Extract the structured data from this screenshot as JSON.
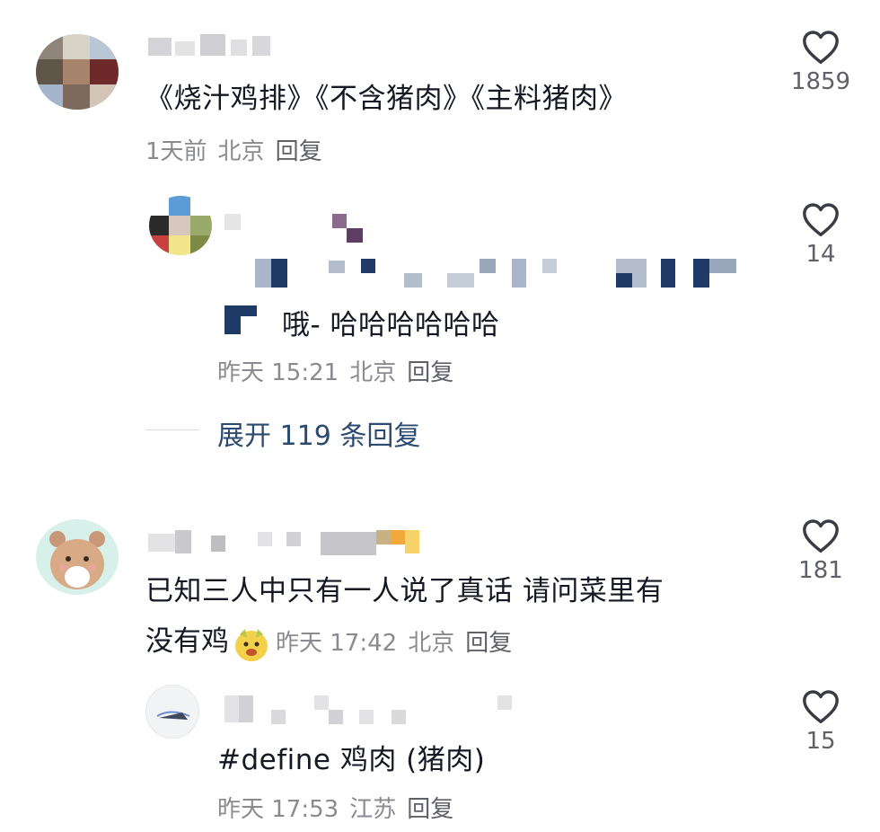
{
  "comments": [
    {
      "content": "《烧汁鸡排》《不含猪肉》《主料猪肉》",
      "time": "1天前",
      "location": "北京",
      "reply_label": "回复",
      "likes": "1859",
      "replies": [
        {
          "content": "哦- 哈哈哈哈哈哈",
          "time": "昨天 15:21",
          "location": "北京",
          "reply_label": "回复",
          "likes": "14"
        }
      ],
      "expand_label": "展开 119 条回复"
    },
    {
      "content_line1": "已知三人中只有一人说了真话 请问菜里有",
      "content_line2": "没有鸡",
      "time": "昨天 17:42",
      "location": "北京",
      "reply_label": "回复",
      "likes": "181",
      "replies": [
        {
          "content": "#define 鸡肉 (猪肉)",
          "time": "昨天 17:53",
          "location": "江苏",
          "reply_label": "回复",
          "likes": "15"
        }
      ]
    }
  ],
  "icons": {
    "like": "heart-outline-icon",
    "emoji": "dog-face-emoji"
  },
  "colors": {
    "text": "#161823",
    "meta": "#8a8b91",
    "link": "#2b4a6f"
  }
}
